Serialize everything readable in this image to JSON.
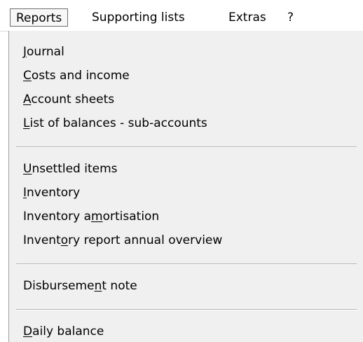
{
  "menubar": {
    "items": [
      {
        "label": "Reports"
      },
      {
        "label": "Supporting lists"
      },
      {
        "label": "Extras"
      },
      {
        "label": "?"
      }
    ]
  },
  "reports_menu": {
    "groups": [
      [
        {
          "label": "Journal",
          "mnemonic": "J"
        },
        {
          "label": "Costs and income",
          "mnemonic": "C"
        },
        {
          "label": "Account sheets",
          "mnemonic": "A"
        },
        {
          "label": "List of balances - sub-accounts",
          "mnemonic": "L"
        }
      ],
      [
        {
          "label": "Unsettled items",
          "mnemonic": "U"
        },
        {
          "label": "Inventory",
          "mnemonic": "I"
        },
        {
          "label": "Inventory amortisation",
          "mnemonic": "m"
        },
        {
          "label": "Inventory report annual overview",
          "mnemonic": "o"
        }
      ],
      [
        {
          "label": "Disbursement note",
          "mnemonic": "n"
        }
      ],
      [
        {
          "label": "Daily balance",
          "mnemonic": "D"
        }
      ]
    ]
  }
}
